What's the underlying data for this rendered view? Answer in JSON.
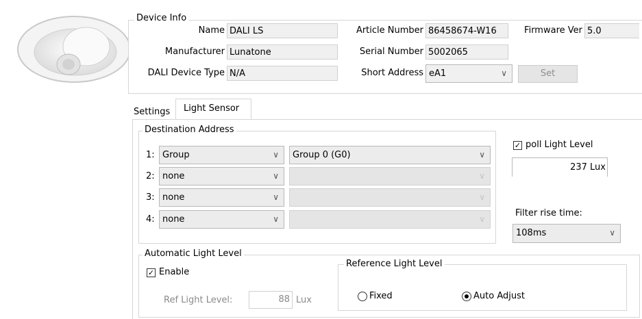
{
  "device_info": {
    "title": "Device Info",
    "name_label": "Name",
    "name_value": "DALI LS",
    "manufacturer_label": "Manufacturer",
    "manufacturer_value": "Lunatone",
    "device_type_label": "DALI Device Type",
    "device_type_value": "N/A",
    "article_label": "Article Number",
    "article_value": "86458674-W16",
    "serial_label": "Serial Number",
    "serial_value": "5002065",
    "short_address_label": "Short Address",
    "short_address_value": "eA1",
    "firmware_label": "Firmware Ver",
    "firmware_value": "5.0",
    "set_button": "Set"
  },
  "tabs": [
    {
      "label": "Settings",
      "active": false
    },
    {
      "label": "Light Sensor",
      "active": true
    }
  ],
  "destination": {
    "title": "Destination Address",
    "rows": [
      {
        "num": "1:",
        "type": "Group",
        "target": "Group 0 (G0)"
      },
      {
        "num": "2:",
        "type": "none",
        "target": ""
      },
      {
        "num": "3:",
        "type": "none",
        "target": ""
      },
      {
        "num": "4:",
        "type": "none",
        "target": ""
      }
    ]
  },
  "poll": {
    "label": "poll Light Level",
    "checked": true,
    "value": "237 Lux"
  },
  "filter": {
    "label": "Filter rise time:",
    "value": "108ms"
  },
  "auto_level": {
    "title": "Automatic Light Level",
    "enable_label": "Enable",
    "enable_checked": true,
    "ref_label": "Ref Light Level:",
    "ref_value": "88",
    "ref_unit": "Lux"
  },
  "reference": {
    "title": "Reference Light Level",
    "options": [
      "Fixed",
      "Auto Adjust"
    ],
    "selected": "Auto Adjust"
  }
}
